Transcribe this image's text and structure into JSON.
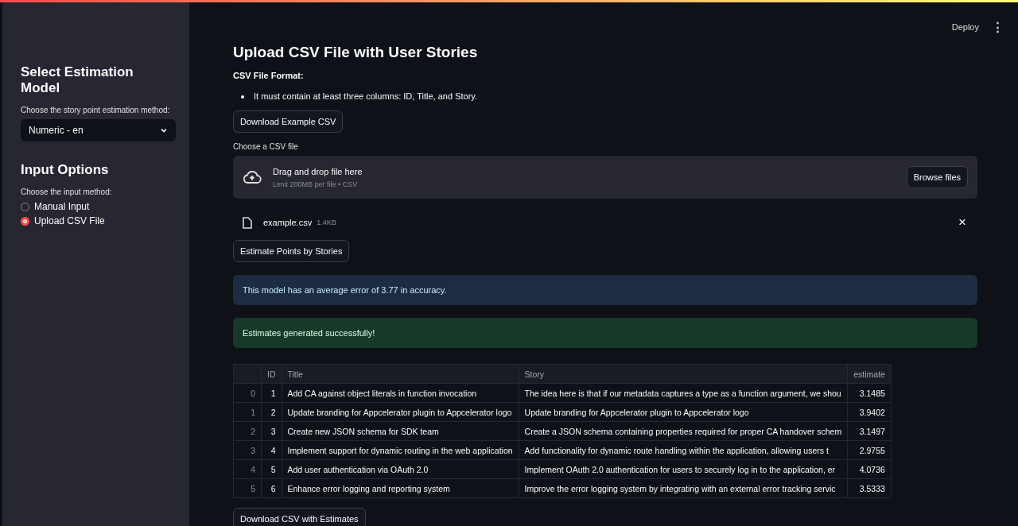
{
  "header": {
    "deploy": "Deploy",
    "menu": "⋮"
  },
  "sidebar": {
    "model_heading": "Select Estimation Model",
    "model_label": "Choose the story point estimation method:",
    "model_value": "Numeric - en",
    "input_heading": "Input Options",
    "input_label": "Choose the input method:",
    "input_options": [
      {
        "label": "Manual Input",
        "selected": false
      },
      {
        "label": "Upload CSV File",
        "selected": true
      }
    ]
  },
  "main": {
    "title": "Upload CSV File with User Stories",
    "format_heading": "CSV File Format:",
    "format_items": [
      "It must contain at least three columns: ID, Title, and Story."
    ],
    "download_example": "Download Example CSV",
    "uploader_label": "Choose a CSV file",
    "dropzone_title": "Drag and drop file here",
    "dropzone_hint": "Limit 200MB per file • CSV",
    "browse": "Browse files",
    "file": {
      "name": "example.csv",
      "size": "1.4KB",
      "remove": "×"
    },
    "estimate_button": "Estimate Points by Stories",
    "alerts": [
      {
        "kind": "info",
        "text": "This model has an average error of 3.77 in accuracy."
      },
      {
        "kind": "success",
        "text": "Estimates generated successfully!"
      }
    ],
    "table": {
      "columns": [
        "ID",
        "Title",
        "Story",
        "estimate"
      ],
      "rows": [
        {
          "index": "0",
          "cells": [
            "1",
            "Add CA against object literals in function invocation",
            "The idea here is that if our metadata captures a type as a function argument, we shou",
            "3.1485"
          ]
        },
        {
          "index": "1",
          "cells": [
            "2",
            "Update branding for Appcelerator plugin to Appcelerator logo",
            "Update branding for Appcelerator plugin to Appcelerator logo",
            "3.9402"
          ]
        },
        {
          "index": "2",
          "cells": [
            "3",
            "Create new JSON schema for SDK team",
            "Create a JSON schema containing properties required for proper CA handover schem",
            "3.1497"
          ]
        },
        {
          "index": "3",
          "cells": [
            "4",
            "Implement support for dynamic routing in the web application",
            "Add functionality for dynamic route handling within the application, allowing users t",
            "2.9755"
          ]
        },
        {
          "index": "4",
          "cells": [
            "5",
            "Add user authentication via OAuth 2.0",
            "Implement OAuth 2.0 authentication for users to securely log in to the application, er",
            "4.0736"
          ]
        },
        {
          "index": "5",
          "cells": [
            "6",
            "Enhance error logging and reporting system",
            "Improve the error logging system by integrating with an external error tracking servic",
            "3.5333"
          ]
        }
      ]
    },
    "download_estimates": "Download CSV with Estimates"
  }
}
